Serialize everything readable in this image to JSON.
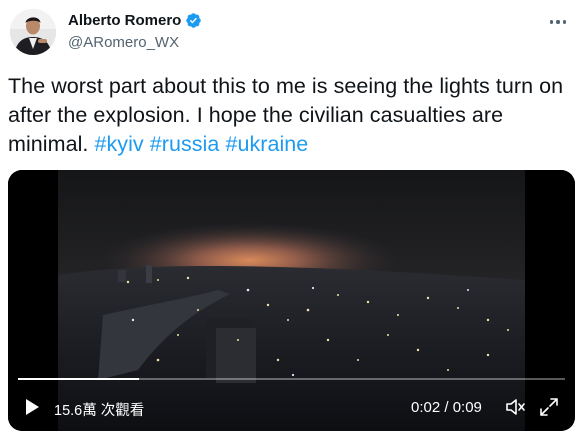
{
  "author": {
    "display_name": "Alberto Romero",
    "handle": "@ARomero_WX",
    "verified": true
  },
  "tweet": {
    "text": "The worst part about this to me is seeing the lights turn on after the explosion. I hope the civilian casualties are minimal.",
    "hashtags": [
      "#kyiv",
      "#russia",
      "#ukraine"
    ]
  },
  "video": {
    "views_label": "15.6萬 次觀看",
    "time_label": "0:02 / 0:09",
    "progress_fraction": 0.222
  },
  "colors": {
    "link": "#1d9bf0",
    "text": "#0f1419",
    "secondary": "#536471"
  },
  "icons": [
    "verified-badge-icon",
    "more-options-icon",
    "play-icon",
    "volume-icon",
    "fullscreen-icon"
  ]
}
